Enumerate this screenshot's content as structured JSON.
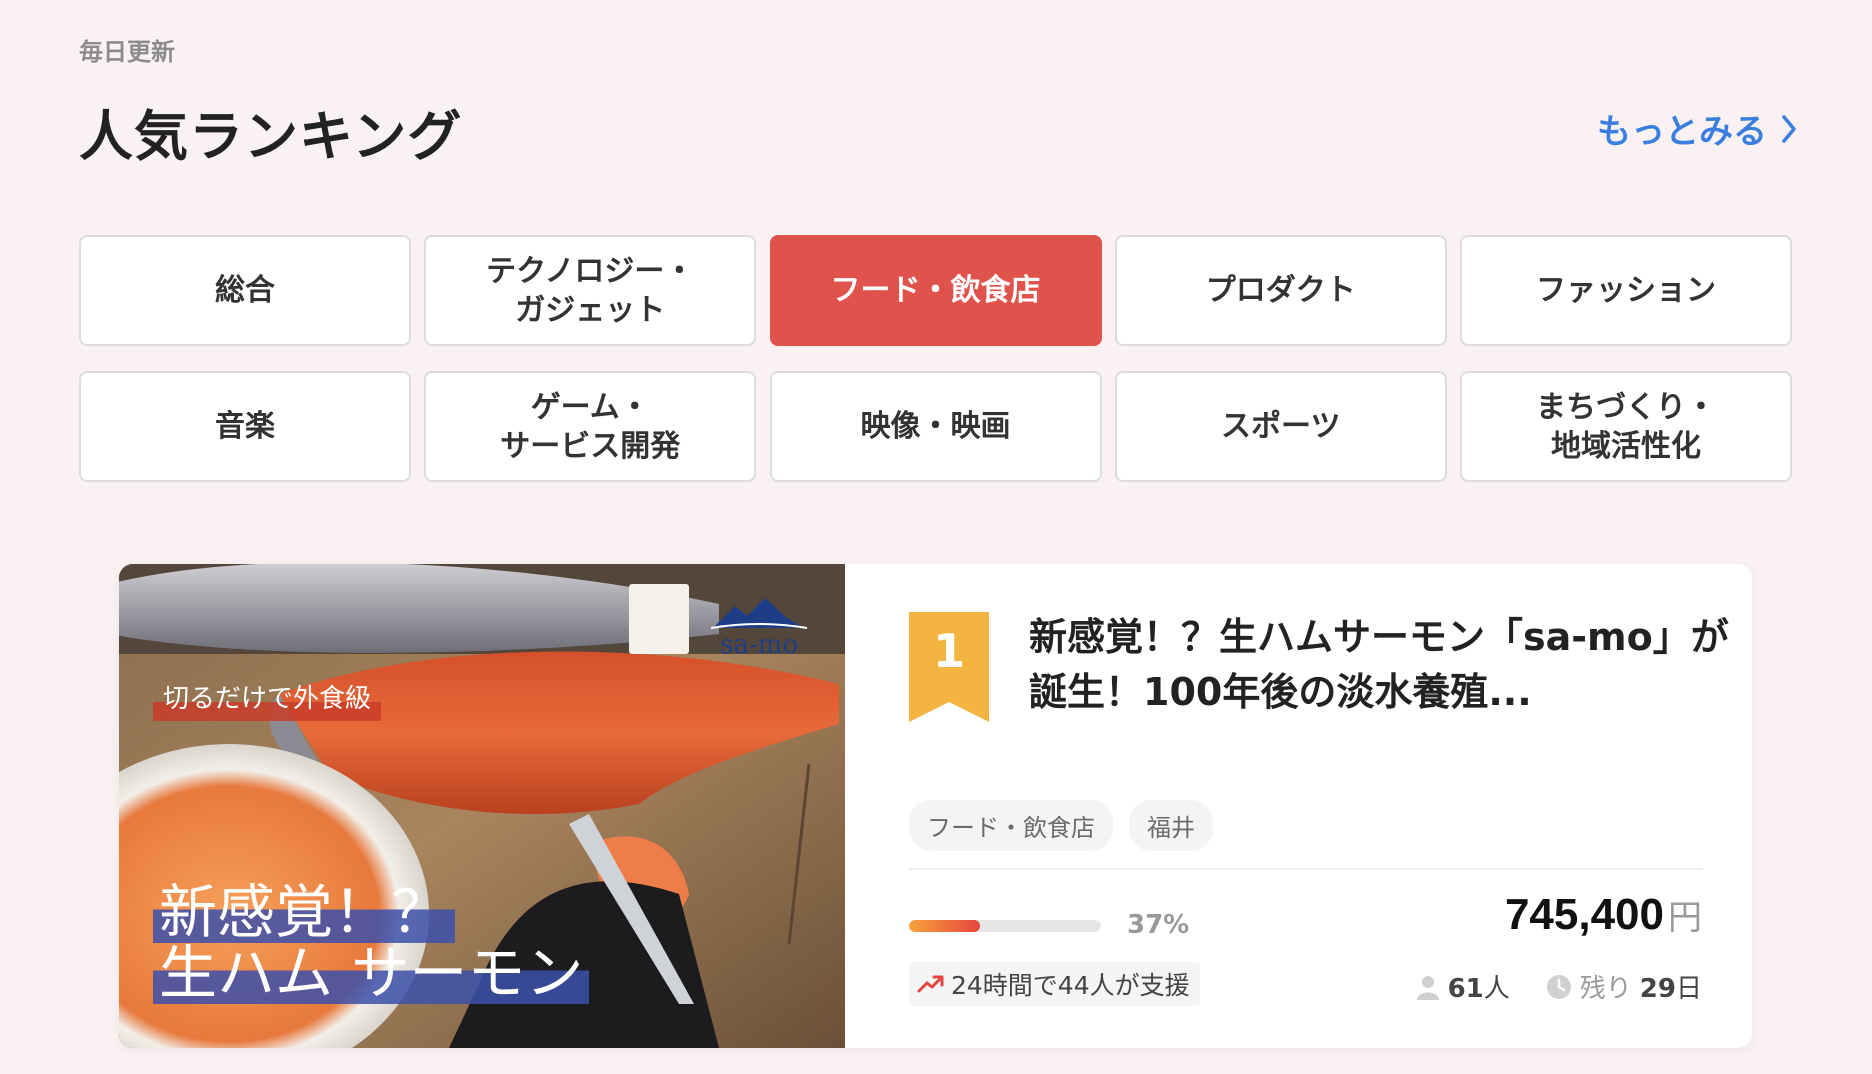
{
  "header": {
    "subtitle": "毎日更新",
    "title": "人気ランキング",
    "more_label": "もっとみる"
  },
  "categories": [
    {
      "label": "総合",
      "active": false
    },
    {
      "label": "テクノロジー・\nガジェット",
      "active": false
    },
    {
      "label": "フード・飲食店",
      "active": true
    },
    {
      "label": "プロダクト",
      "active": false
    },
    {
      "label": "ファッション",
      "active": false
    },
    {
      "label": "音楽",
      "active": false
    },
    {
      "label": "ゲーム・\nサービス開発",
      "active": false
    },
    {
      "label": "映像・映画",
      "active": false
    },
    {
      "label": "スポーツ",
      "active": false
    },
    {
      "label": "まちづくり・\n地域活性化",
      "active": false
    }
  ],
  "project": {
    "rank": "1",
    "title": "新感覚！？生ハムサーモン「sa-mo」が誕生！100年後の淡水養殖...",
    "thumbnail": {
      "logo": "sa-mo",
      "tagline": "切るだけで外食級",
      "headline_line1": "新感覚！？",
      "headline_line2": "生ハム サーモン"
    },
    "tags": [
      "フード・飲食店",
      "福井"
    ],
    "progress_percent": 37,
    "percent_label": "37%",
    "amount": "745,400",
    "amount_unit": "円",
    "trend_label": "24時間で44人が支援",
    "supporters_value": "61",
    "supporters_unit": "人",
    "remaining_label": "残り",
    "remaining_days": "29",
    "remaining_unit": "日"
  },
  "colors": {
    "background": "#faf2f2",
    "accent_red": "#e0534c",
    "link_blue": "#3a7fe0",
    "rank_gold": "#f3b53f"
  }
}
